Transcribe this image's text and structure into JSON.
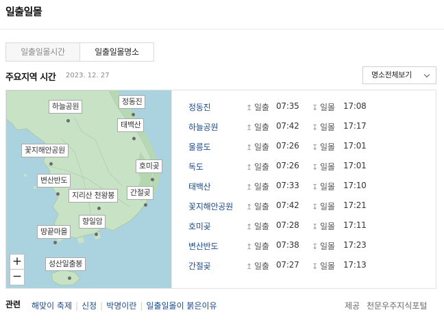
{
  "header": {
    "title": "일출일몰"
  },
  "tabs": [
    {
      "label": "일출일몰시간",
      "active": false
    },
    {
      "label": "일출일몰명소",
      "active": true
    }
  ],
  "section": {
    "title": "주요지역 시간",
    "date": "2023. 12. 27"
  },
  "dropdown": {
    "label": "명소전체보기"
  },
  "map": {
    "markers": [
      "하늘공원",
      "정동진",
      "태백산",
      "꽃지해안공원",
      "호미곶",
      "변산반도",
      "지리산 천왕봉",
      "간절곶",
      "땅끝마을",
      "향일암",
      "성산일출봉"
    ],
    "zoom_in": "+",
    "zoom_out": "−"
  },
  "labels": {
    "sunrise": "일출",
    "sunset": "일몰",
    "up_arrow": "↥",
    "down_arrow": "↧"
  },
  "spots": [
    {
      "name": "정동진",
      "sunrise": "07:35",
      "sunset": "17:08"
    },
    {
      "name": "하늘공원",
      "sunrise": "07:42",
      "sunset": "17:17"
    },
    {
      "name": "울릉도",
      "sunrise": "07:26",
      "sunset": "17:01"
    },
    {
      "name": "독도",
      "sunrise": "07:26",
      "sunset": "17:01"
    },
    {
      "name": "태백산",
      "sunrise": "07:33",
      "sunset": "17:10"
    },
    {
      "name": "꽃지해안공원",
      "sunrise": "07:42",
      "sunset": "17:21"
    },
    {
      "name": "호미곶",
      "sunrise": "07:28",
      "sunset": "17:11"
    },
    {
      "name": "변산반도",
      "sunrise": "07:38",
      "sunset": "17:23"
    },
    {
      "name": "간절곶",
      "sunrise": "07:27",
      "sunset": "17:13"
    }
  ],
  "footer": {
    "related_label": "관련",
    "links": [
      "해맞이 축제",
      "신정",
      "박명이란",
      "일출일몰이 붉은이유"
    ],
    "source_label": "제공",
    "source_name": "천문우주지식포털"
  },
  "colors": {
    "link": "#1a4a8a",
    "sea": "#aad3df",
    "land": "#c8e2c5"
  }
}
